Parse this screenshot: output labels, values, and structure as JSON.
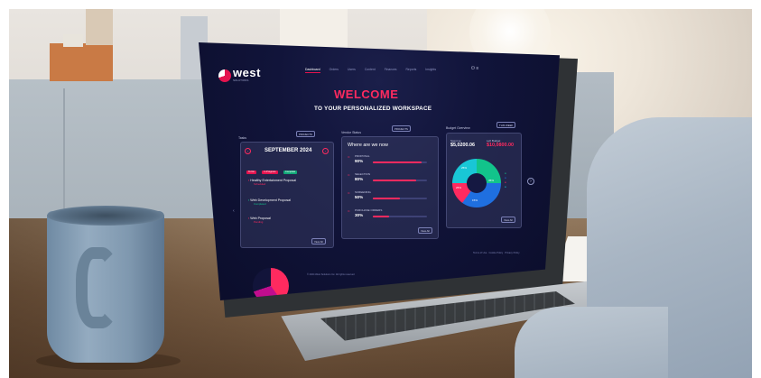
{
  "screen": {
    "brand": {
      "name": "west",
      "subtitle": "SOLUTIONS"
    },
    "nav": [
      {
        "label": "Dashboard",
        "active": true
      },
      {
        "label": "Orders",
        "active": false
      },
      {
        "label": "Users",
        "active": false
      },
      {
        "label": "Content",
        "active": false
      },
      {
        "label": "Finances",
        "active": false
      },
      {
        "label": "Reports",
        "active": false
      },
      {
        "label": "Insights",
        "active": false
      }
    ],
    "welcome_title": "WELCOME",
    "welcome_subtitle": "TO YOUR PERSONALIZED WORKSPACE",
    "tasks": {
      "label": "Tasks",
      "filter": "PROJECTS",
      "month": "SEPTEMBER 2024",
      "tags": [
        "To Do",
        "In Progress",
        "Complete"
      ],
      "items": [
        {
          "title": "Healthy Entertainment Proposal",
          "status": "Scheduled"
        },
        {
          "title": "Web Development Proposal",
          "status": "Completed"
        },
        {
          "title": "Web Proposal",
          "status": "Pending"
        }
      ],
      "view_all": "View All"
    },
    "where": {
      "label": "Vendor Status",
      "filter": "PROJECTS",
      "title": "Where are we now",
      "items": [
        {
          "label": "PROPOSAL",
          "value": "90%",
          "fraction": 0.9
        },
        {
          "label": "SELECTION",
          "value": "80%",
          "fraction": 0.8
        },
        {
          "label": "SCREENING",
          "value": "50%",
          "fraction": 0.5
        },
        {
          "label": "PURCHASE ORDERS",
          "value": "30%",
          "fraction": 0.3
        }
      ],
      "view_all": "View All"
    },
    "budget": {
      "label": "Budget Overview",
      "filter": "THIS WEEK",
      "spent_label": "Spent so",
      "spent_value": "$5,0200.06",
      "left_label": "Left Budget",
      "left_value": "$10,0800.00",
      "slices": [
        {
          "label": "25%",
          "color": "#12c48b",
          "fraction": 0.25
        },
        {
          "label": "35%",
          "color": "#1f6fe0",
          "fraction": 0.35
        },
        {
          "label": "15%",
          "color": "#ff2a5f",
          "fraction": 0.15
        },
        {
          "label": "25%",
          "color": "#19c6d6",
          "fraction": 0.25
        }
      ],
      "view_all": "View All"
    },
    "footer": "© 2024 West Solutions Inc. All rights reserved",
    "footer_links": [
      "Terms of Use",
      "Cookie Policy",
      "Privacy Policy"
    ]
  },
  "colors": {
    "accent": "#ff2a5f",
    "screen_bg": "#11143a",
    "mug": "#7f98af"
  }
}
